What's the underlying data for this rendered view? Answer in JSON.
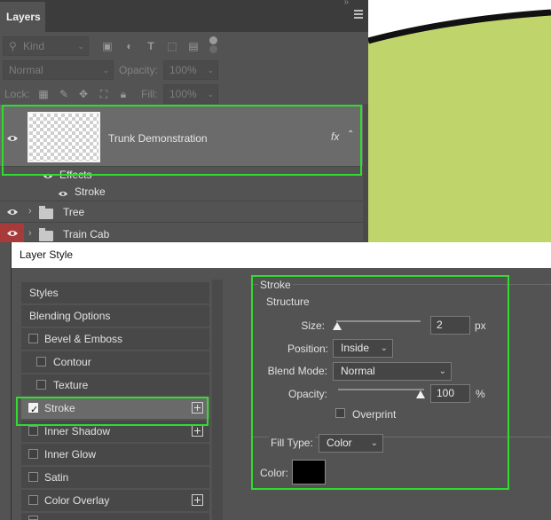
{
  "layers_panel": {
    "tab_label": "Layers",
    "filter_kind": "Kind",
    "blend_mode": "Normal",
    "opacity_label": "Opacity:",
    "opacity_value": "100%",
    "lock_label": "Lock:",
    "fill_label": "Fill:",
    "fill_value": "100%",
    "layers": [
      {
        "name": "Trunk Demonstration",
        "fx": "fx",
        "selected": true
      },
      {
        "name": "Effects",
        "sub": true
      },
      {
        "name": "Stroke",
        "sub": true
      },
      {
        "name": "Tree",
        "type": "group"
      },
      {
        "name": "Train Cab",
        "type": "group"
      }
    ]
  },
  "canvas": {
    "shape_color": "#bfd56c",
    "outline_color": "#111111"
  },
  "dialog": {
    "title": "Layer Style",
    "styles": [
      {
        "label": "Styles"
      },
      {
        "label": "Blending Options"
      },
      {
        "label": "Bevel & Emboss",
        "checked": false
      },
      {
        "label": "Contour",
        "checked": false
      },
      {
        "label": "Texture",
        "checked": false
      },
      {
        "label": "Stroke",
        "checked": true
      },
      {
        "label": "Inner Shadow",
        "checked": false
      },
      {
        "label": "Inner Glow",
        "checked": false
      },
      {
        "label": "Satin",
        "checked": false
      },
      {
        "label": "Color Overlay",
        "checked": false
      }
    ],
    "stroke": {
      "group_title": "Stroke",
      "structure_title": "Structure",
      "size_label": "Size:",
      "size_value": "2",
      "size_unit": "px",
      "position_label": "Position:",
      "position_value": "Inside",
      "blend_mode_label": "Blend Mode:",
      "blend_mode_value": "Normal",
      "opacity_label": "Opacity:",
      "opacity_value": "100",
      "opacity_unit": "%",
      "overprint_label": "Overprint",
      "fill_type_label": "Fill Type:",
      "fill_type_value": "Color",
      "color_label": "Color:",
      "color_value": "#000000"
    }
  },
  "highlight_color": "#2fdc2f"
}
